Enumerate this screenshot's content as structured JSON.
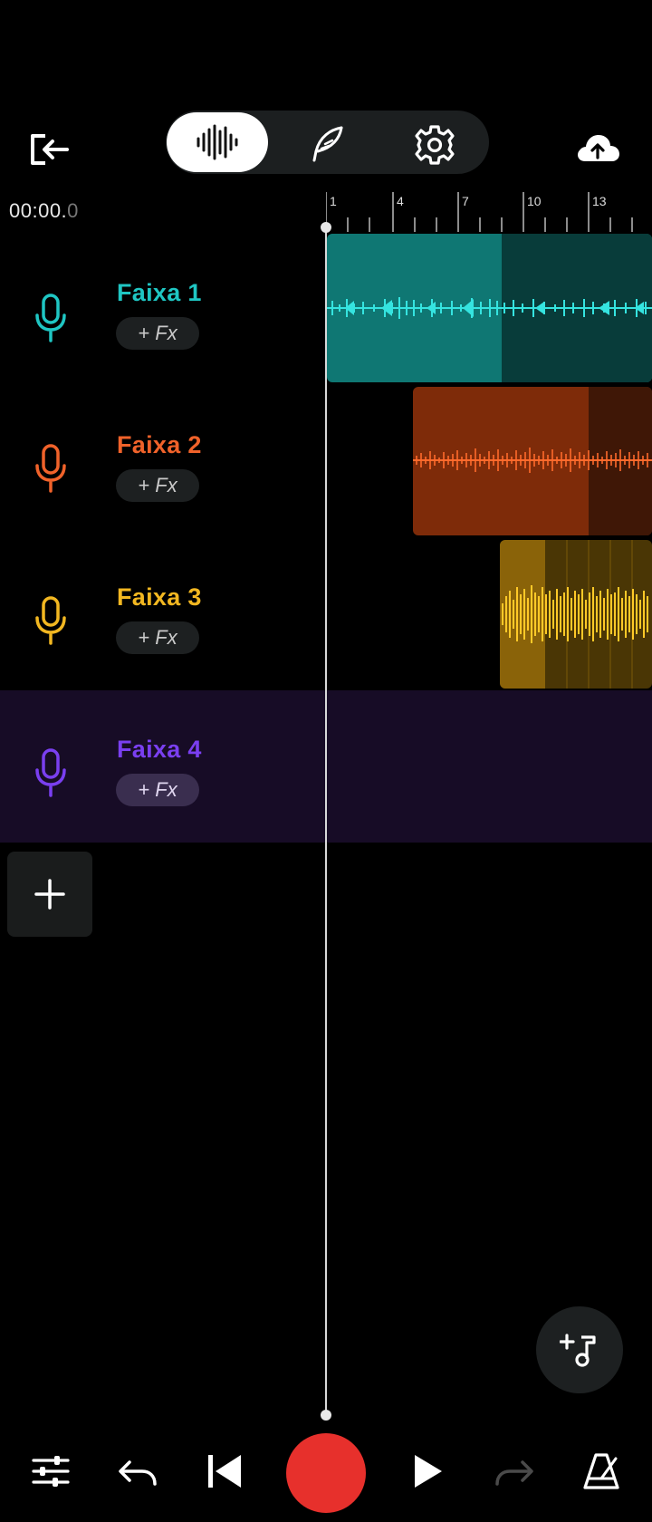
{
  "header": {
    "exit_icon": "exit-icon",
    "modes": [
      {
        "icon": "waveform-icon",
        "active": true
      },
      {
        "icon": "quill-icon",
        "active": false
      },
      {
        "icon": "gear-icon",
        "active": false
      }
    ],
    "upload_icon": "cloud-upload-icon"
  },
  "timeline": {
    "time_main": "00:00.",
    "time_fraction": "0",
    "ruler_labels": [
      "1",
      "4",
      "7",
      "10",
      "13"
    ]
  },
  "tracks": [
    {
      "name": "Faixa 1",
      "fx_label": "+ Fx",
      "color": "#1fc6c3",
      "clip_color": "#0f7773",
      "clip_dark": "#083c3a"
    },
    {
      "name": "Faixa 2",
      "fx_label": "+ Fx",
      "color": "#f0622a",
      "clip_color": "#7e2b09",
      "clip_dark": "#3f1706"
    },
    {
      "name": "Faixa 3",
      "fx_label": "+ Fx",
      "color": "#f2b721",
      "clip_color": "#8a6309",
      "clip_dark": "#4a3605"
    },
    {
      "name": "Faixa 4",
      "fx_label": "+ Fx",
      "color": "#7a3ff0",
      "selected": true
    }
  ],
  "controls": {
    "add_track_icon": "plus-icon",
    "note_icon": "add-note-icon",
    "bottom": [
      "mixer-icon",
      "undo-icon",
      "skip-back-icon",
      "record-button",
      "play-icon",
      "redo-icon",
      "metronome-icon"
    ],
    "record_color": "#e7302c"
  }
}
